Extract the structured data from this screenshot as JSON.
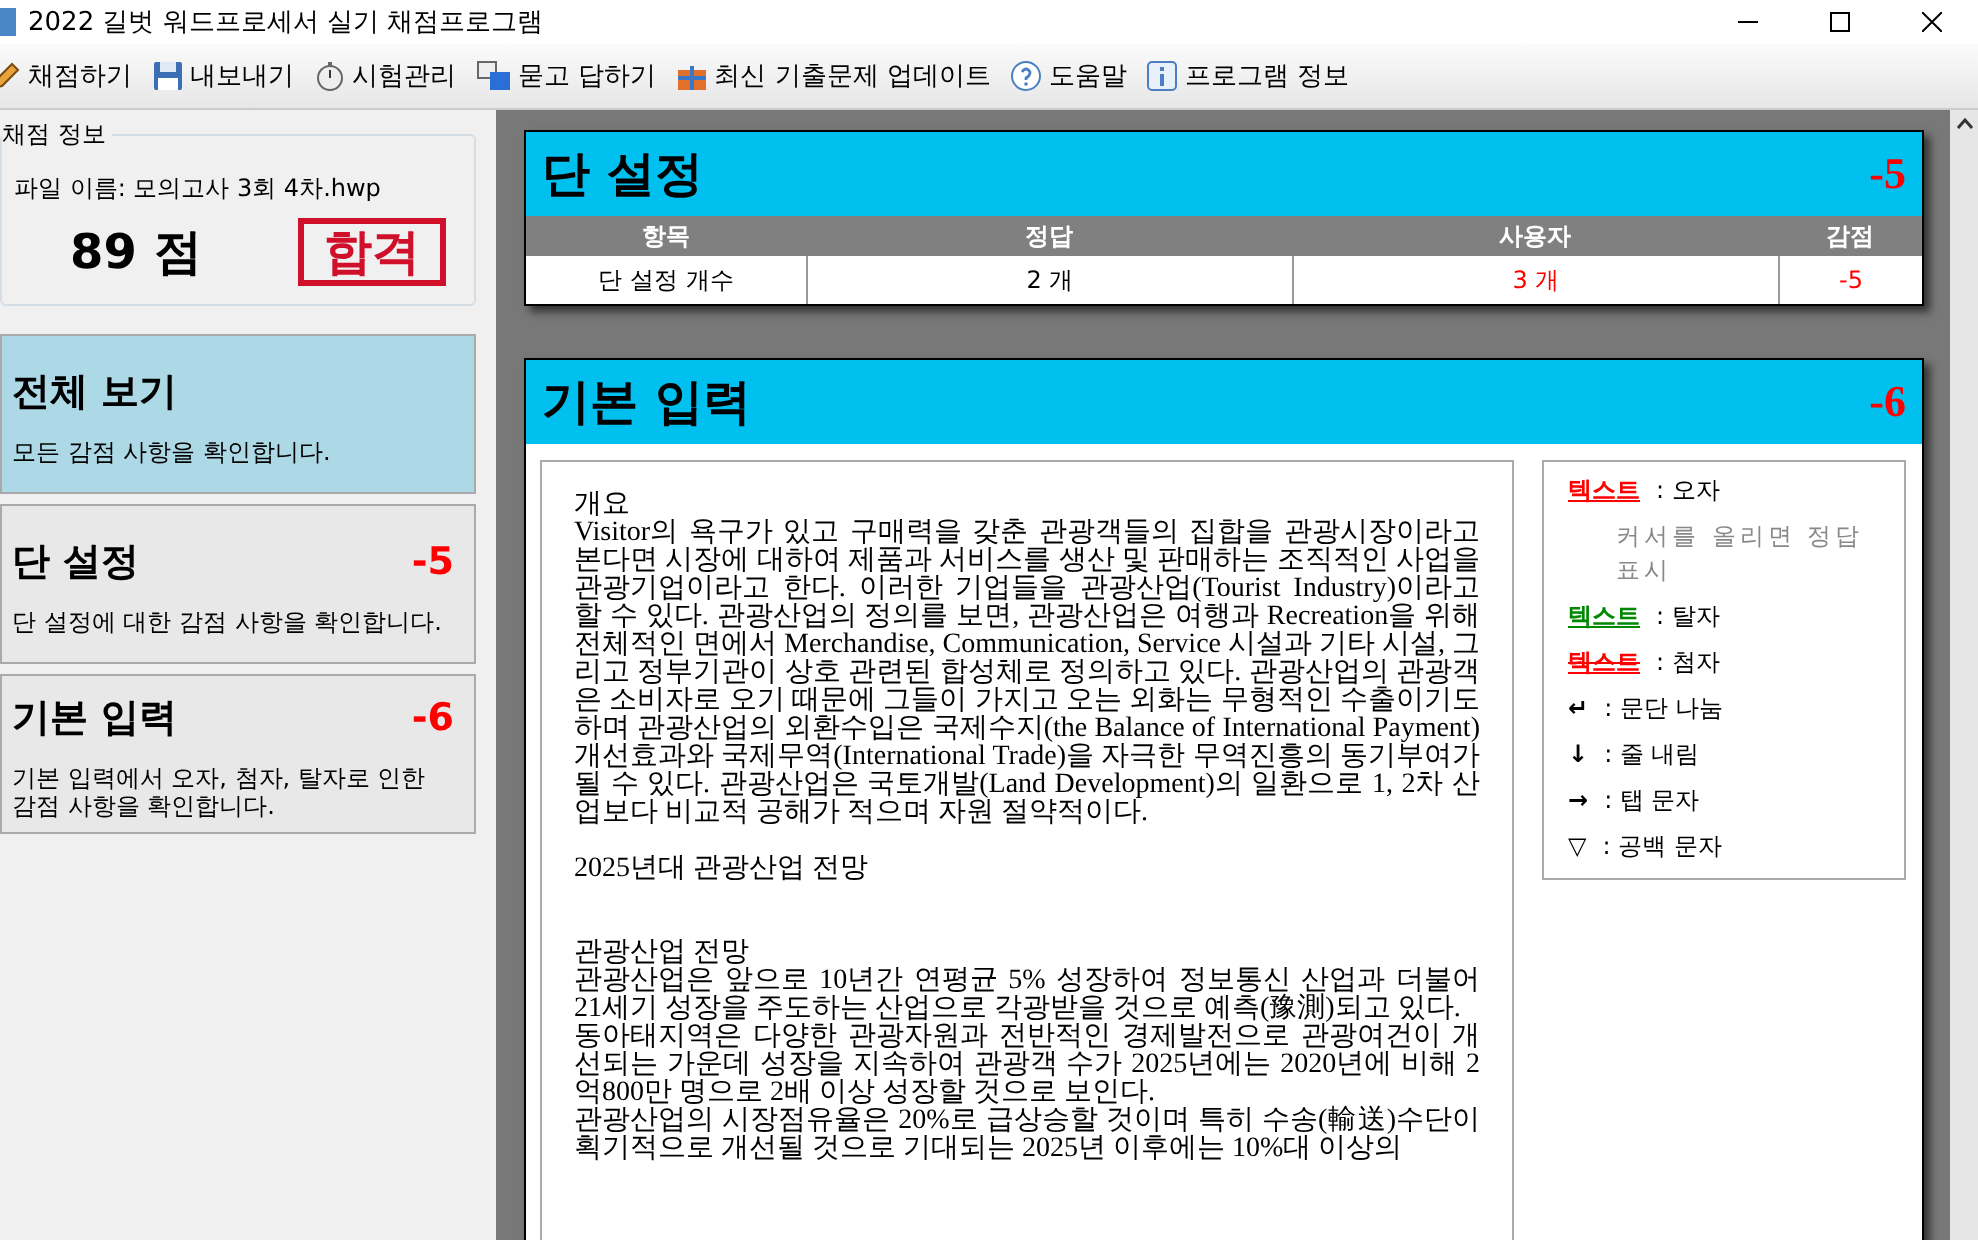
{
  "window": {
    "title": "2022 길벗 워드프로세서 실기 채점프로그램"
  },
  "toolbar": [
    {
      "label": "채점하기"
    },
    {
      "label": "내보내기"
    },
    {
      "label": "시험관리"
    },
    {
      "label": "묻고 답하기"
    },
    {
      "label": "최신 기출문제 업데이트"
    },
    {
      "label": "도움말"
    },
    {
      "label": "프로그램 정보"
    }
  ],
  "sidebar": {
    "group_title": "채점 정보",
    "file_name": "파일 이름: 모의고사 3회 4차.hwp",
    "score": "89 점",
    "stamp": "합격",
    "items": [
      {
        "title": "전체 보기",
        "description": "모든 감점 사항을 확인합니다.",
        "selected": true
      },
      {
        "title": "단 설정",
        "deduction": "-5",
        "description": "단 설정에 대한 감점 사항을 확인합니다.",
        "selected": false
      },
      {
        "title": "기본 입력",
        "deduction": "-6",
        "description": "기본 입력에서 오자, 첨자, 탈자로 인한 감점 사항을 확인합니다.",
        "selected": false
      }
    ]
  },
  "sections": [
    {
      "kind": "table",
      "title": "단 설정",
      "deduction": "-5",
      "columns": [
        "항목",
        "정답",
        "사용자",
        "감점"
      ],
      "rows": [
        [
          {
            "text": "단 설정 개수",
            "wrong": false
          },
          {
            "text": "2 개",
            "wrong": false
          },
          {
            "text": "3 개",
            "wrong": true
          },
          {
            "text": "-5",
            "wrong": true
          }
        ]
      ]
    },
    {
      "kind": "document",
      "title": "기본 입력",
      "deduction": "-6",
      "paragraphs": [
        "개요",
        "Visitor의 욕구가 있고 구매력을 갖춘 관광객들의 집합을 관광시장이라고 본다면 시장에 대하여 제품과 서비스를 생산 및 판매하는 조직적인 사업을 관광기업이라고 한다. 이러한 기업들을 관광산업(Tourist Industry)이라고 할 수 있다. 관광산업의 정의를 보면, 관광산업은 여행과 Recreation을 위해 전체적인 면에서 Merchandise, Communication, Service 시설과 기타 시설, 그리고 정부기관이 상호 관련된 합성체로 정의하고 있다. 관광산업의 관광객은 소비자로 오기 때문에 그들이 가지고 오는 외화는 무형적인 수출이기도 하며 관광산업의 외환수입은 국제수지(the Balance of International Payment) 개선효과와 국제무역(International Trade)을 자극한 무역진흥의 동기부여가 될 수 있다. 관광산업은 국토개발(Land Development)의 일환으로 1, 2차 산업보다 비교적 공해가 적으며 자원 절약적이다.",
        "2025년대 관광산업 전망",
        "관광산업 전망",
        "관광산업은 앞으로 10년간 연평균 5% 성장하여 정보통신 산업과 더불어 21세기 성장을 주도하는 산업으로 각광받을 것으로 예측(豫測)되고 있다.",
        "동아태지역은 다양한 관광자원과 전반적인 경제발전으로 관광여건이 개선되는 가운데 성장을 지속하여 관광객 수가 2025년에는 2020년에 비해 2억800만 명으로 2배 이상 성장할 것으로 보인다.",
        "관광산업의 시장점유율은 20%로 급상승할 것이며 특히 수송(輸送)수단이 획기적으로 개선될 것으로 기대되는 2025년 이후에는 10%대 이상의"
      ],
      "legend": [
        {
          "kind": "typo",
          "sample": "텍스트",
          "text": ": 오자",
          "note": "커서를 올리면 정답 표시"
        },
        {
          "kind": "omission",
          "sample": "텍스트",
          "text": ": 탈자"
        },
        {
          "kind": "insertion",
          "sample": "텍스트",
          "text": ": 첨자"
        },
        {
          "kind": "symbol",
          "sample": "↵",
          "text": ": 문단 나눔"
        },
        {
          "kind": "symbol",
          "sample": "↓",
          "text": ": 줄 내림"
        },
        {
          "kind": "symbol",
          "sample": "→",
          "text": ": 탭 문자"
        },
        {
          "kind": "symbol",
          "sample": "▽",
          "text": ": 공백 문자"
        }
      ]
    }
  ]
}
